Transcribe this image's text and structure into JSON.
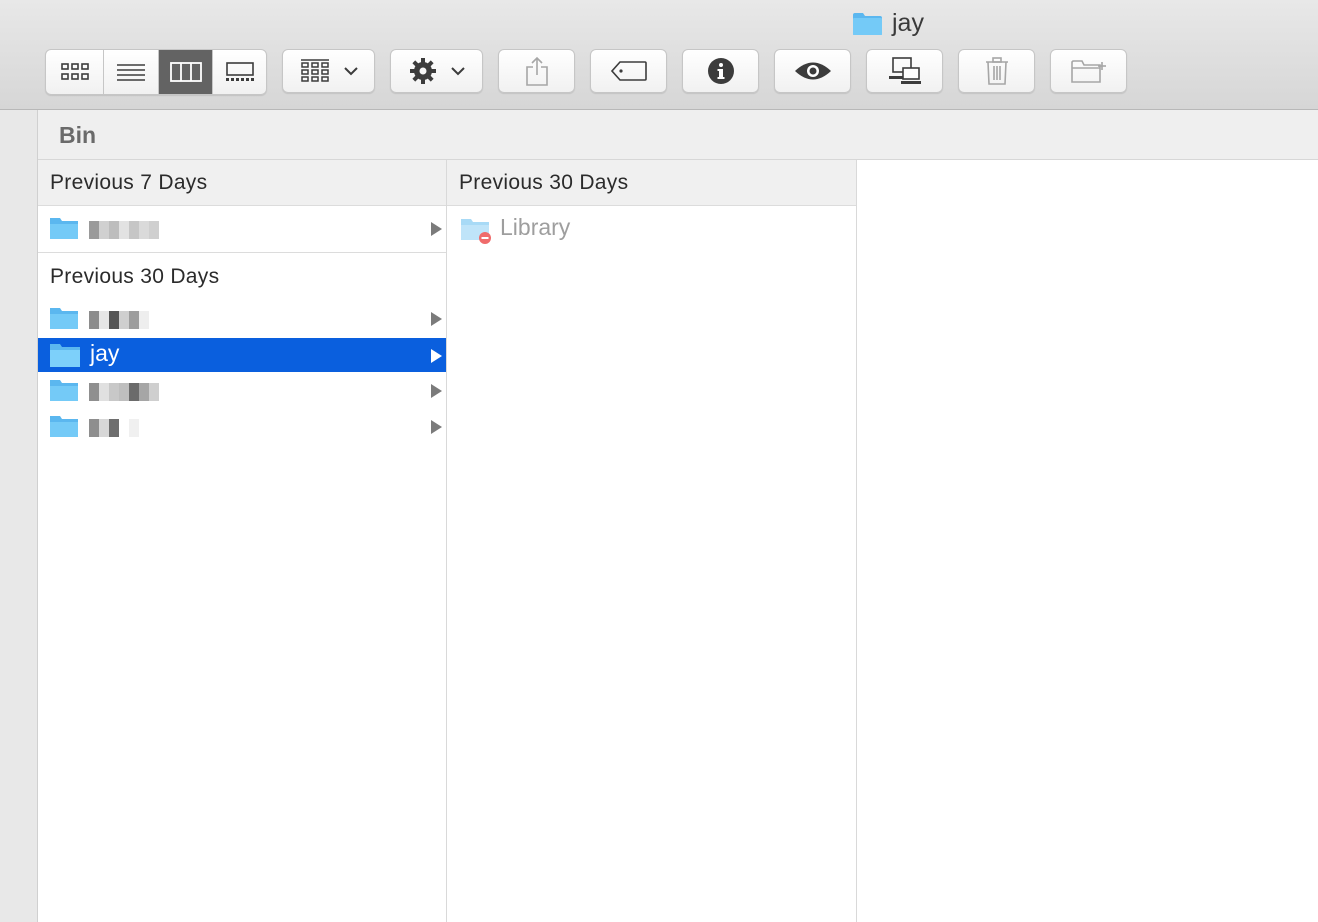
{
  "window": {
    "title": "jay",
    "title_icon": "folder-icon"
  },
  "toolbar": {
    "view_modes": [
      {
        "name": "icon-view",
        "icon": "grid-icon",
        "active": false
      },
      {
        "name": "list-view",
        "icon": "list-icon",
        "active": false
      },
      {
        "name": "column-view",
        "icon": "columns-icon",
        "active": true
      },
      {
        "name": "gallery-view",
        "icon": "gallery-icon",
        "active": false
      }
    ],
    "buttons": [
      {
        "name": "group-by",
        "icon": "group-grid-icon",
        "has_dropdown": true
      },
      {
        "name": "action",
        "icon": "gear-icon",
        "has_dropdown": true
      },
      {
        "name": "share",
        "icon": "share-icon",
        "enabled": false
      },
      {
        "name": "tags",
        "icon": "tag-icon",
        "enabled": true
      },
      {
        "name": "get-info",
        "icon": "info-icon",
        "enabled": true
      },
      {
        "name": "quick-look",
        "icon": "eye-icon",
        "enabled": true
      },
      {
        "name": "connect-to-server",
        "icon": "network-icon",
        "enabled": true
      },
      {
        "name": "move-to-trash",
        "icon": "trash-icon",
        "enabled": false
      },
      {
        "name": "new-folder",
        "icon": "new-folder-icon",
        "enabled": false
      }
    ]
  },
  "pathbar": {
    "label": "Bin"
  },
  "column1": {
    "section1_header": "Previous 7 Days",
    "section2_label": "Previous 30 Days",
    "items": [
      {
        "name": "[redacted]",
        "redacted": true,
        "has_children": true
      },
      {
        "name": "[redacted]",
        "redacted": true,
        "has_children": true
      },
      {
        "name": "jay",
        "redacted": false,
        "selected": true,
        "has_children": true
      },
      {
        "name": "[redacted]",
        "redacted": true,
        "has_children": true
      },
      {
        "name": "[redacted]",
        "redacted": true,
        "has_children": true
      }
    ]
  },
  "column2": {
    "section_header": "Previous 30 Days",
    "items": [
      {
        "name": "Library",
        "dimmed": true,
        "restricted_badge": true,
        "icon": "restricted-folder-icon"
      }
    ]
  },
  "colors": {
    "selection": "#0a5fde",
    "folder_blue": "#6ec6f5",
    "active_view_mode": "#636363"
  }
}
